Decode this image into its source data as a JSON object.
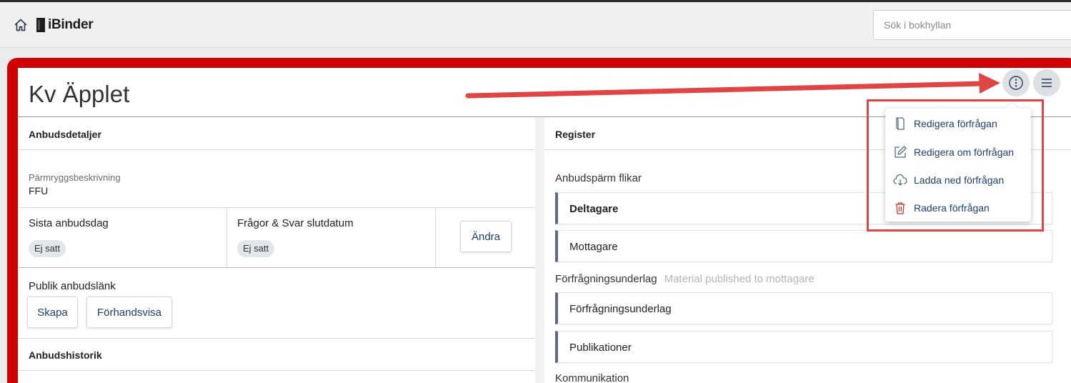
{
  "topbar": {
    "logo_text": "iBinder",
    "search_placeholder": "Sök i bokhyllan"
  },
  "page": {
    "title": "Kv Äpplet"
  },
  "details": {
    "heading": "Anbudsdetaljer",
    "spine_label": "Pärmryggsbeskrivning",
    "spine_value": "FFU",
    "last_day_label": "Sista anbudsdag",
    "last_day_value": "Ej satt",
    "qa_label": "Frågor & Svar slutdatum",
    "qa_value": "Ej satt",
    "change_button": "Ändra",
    "public_link_label": "Publik anbudslänk",
    "create_button": "Skapa",
    "preview_button": "Förhandsvisa",
    "history_heading": "Anbudshistorik"
  },
  "register": {
    "heading": "Register",
    "group1_label": "Anbudspärm flikar",
    "group1_items": [
      "Deltagare",
      "Mottagare"
    ],
    "group2_label": "Förfrågningsunderlag",
    "group2_note": "Material published to mottagare",
    "group2_items": [
      "Förfrågningsunderlag",
      "Publikationer"
    ],
    "group3_label": "Kommunikation"
  },
  "dropdown": {
    "items": [
      {
        "label": "Redigera förfrågan",
        "icon": "binder-icon"
      },
      {
        "label": "Redigera om förfrågan",
        "icon": "edit-icon"
      },
      {
        "label": "Ladda ned förfrågan",
        "icon": "cloud-download-icon"
      },
      {
        "label": "Radera förfrågan",
        "icon": "trash-icon"
      }
    ]
  },
  "colors": {
    "frame": "#d00000",
    "accent_text": "#1f3f6b",
    "tab_border": "#5a6b85",
    "annotation": "#e04545",
    "delete_icon": "#c0392b"
  }
}
